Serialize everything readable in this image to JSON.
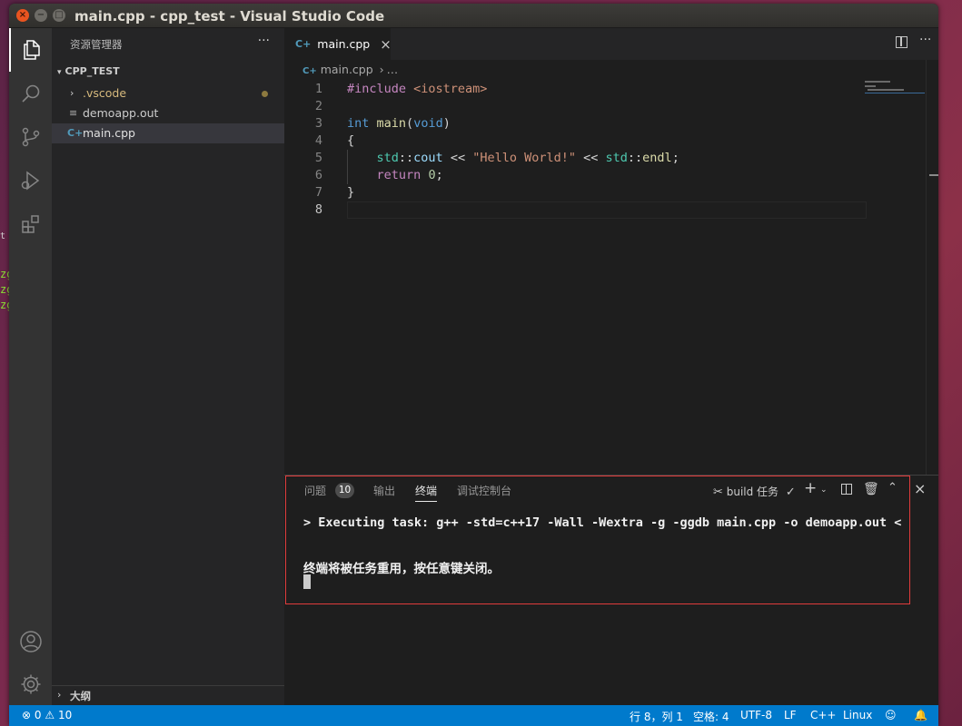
{
  "window": {
    "title": "main.cpp - cpp_test - Visual Studio Code",
    "close": "×",
    "minimize": "−",
    "maximize": "□"
  },
  "desktop": {
    "fragment_1": "t",
    "fragment_2": "zg",
    "fragment_3": "zg",
    "fragment_4": "zg"
  },
  "activity_bar": {
    "icons": [
      "files-icon",
      "search-icon",
      "source-control-icon",
      "run-debug-icon",
      "extensions-icon",
      "account-icon",
      "settings-gear-icon"
    ]
  },
  "sidebar": {
    "header": "资源管理器",
    "more": "···",
    "section": "CPP_TEST",
    "items": [
      {
        "label": ".vscode",
        "type": "folder",
        "color": "#d7ba7d",
        "modified_dot": true
      },
      {
        "label": "demoapp.out",
        "type": "file"
      },
      {
        "label": "main.cpp",
        "type": "cpp-file",
        "selected": true
      }
    ],
    "outline": "大纲"
  },
  "editor": {
    "tab": {
      "label": "main.cpp",
      "close": "×"
    },
    "breadcrumb": {
      "file": "main.cpp",
      "sep": "›",
      "rest": "…"
    },
    "lines": [
      {
        "n": "1",
        "tokens": [
          [
            "k-pre",
            "#include "
          ],
          [
            "k-str",
            "<iostream>"
          ]
        ]
      },
      {
        "n": "2",
        "tokens": []
      },
      {
        "n": "3",
        "tokens": [
          [
            "k-type",
            "int"
          ],
          [
            "k-op",
            " "
          ],
          [
            "k-fn",
            "main"
          ],
          [
            "k-op",
            "("
          ],
          [
            "k-type",
            "void"
          ],
          [
            "k-op",
            ")"
          ]
        ]
      },
      {
        "n": "4",
        "tokens": [
          [
            "k-op",
            "{"
          ]
        ]
      },
      {
        "n": "5",
        "tokens": [
          [
            "k-op",
            "    "
          ],
          [
            "k-ns",
            "std"
          ],
          [
            "k-op",
            "::"
          ],
          [
            "k-var",
            "cout"
          ],
          [
            "k-op",
            " << "
          ],
          [
            "k-str",
            "\"Hello World!\""
          ],
          [
            "k-op",
            " << "
          ],
          [
            "k-ns",
            "std"
          ],
          [
            "k-op",
            "::"
          ],
          [
            "k-fn",
            "endl"
          ],
          [
            "k-op",
            ";"
          ]
        ]
      },
      {
        "n": "6",
        "tokens": [
          [
            "k-op",
            "    "
          ],
          [
            "k-pre",
            "return"
          ],
          [
            "k-op",
            " "
          ],
          [
            "k-num",
            "0"
          ],
          [
            "k-op",
            ";"
          ]
        ]
      },
      {
        "n": "7",
        "tokens": [
          [
            "k-op",
            "}"
          ]
        ]
      },
      {
        "n": "8",
        "tokens": [],
        "current": true
      }
    ]
  },
  "panel": {
    "tabs": [
      {
        "label": "问题",
        "badge": "10"
      },
      {
        "label": "输出"
      },
      {
        "label": "终端",
        "active": true
      },
      {
        "label": "调试控制台"
      }
    ],
    "task_label": "build 任务",
    "terminal": {
      "line1": "> Executing task: g++ -std=c++17 -Wall -Wextra -g -ggdb main.cpp -o demoapp.out <",
      "line2": "终端将被任务重用，按任意键关闭。"
    }
  },
  "statusbar": {
    "errors": "0",
    "warnings": "10",
    "position": "行 8，列 1",
    "spaces": "空格: 4",
    "encoding": "UTF-8",
    "eol": "LF",
    "language": "C++",
    "platform": "Linux"
  },
  "colors": {
    "accent": "#007acc",
    "panel_highlight": "#e03c3c",
    "title_close": "#e95420"
  }
}
